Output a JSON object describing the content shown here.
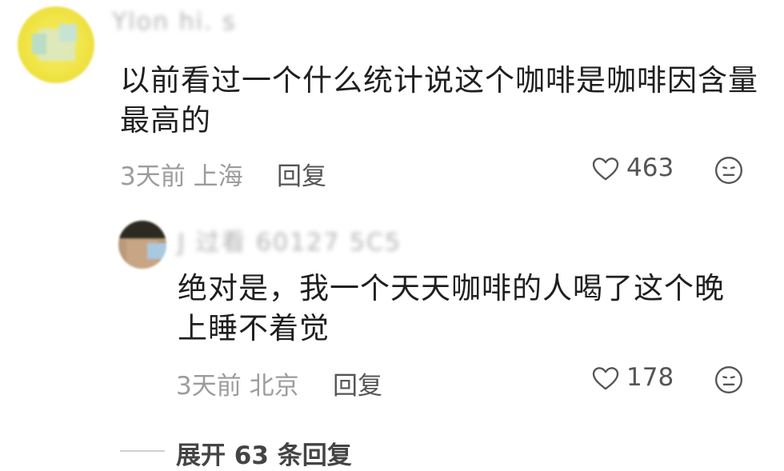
{
  "comment": {
    "username": "Ylon hi. s",
    "text": "以前看过一个什么统计说这个咖啡是咖啡因含量最高的",
    "meta": "3天前 上海",
    "reply_label": "回复",
    "likes": "463",
    "icons": {
      "like": "heart-icon",
      "dislike": "neutral-face-icon"
    }
  },
  "reply": {
    "username": "J 过看 60127 5C5",
    "text": "绝对是，我一个天天咖啡的人喝了这个晚上睡不着觉",
    "meta": "3天前 北京",
    "reply_label": "回复",
    "likes": "178",
    "icons": {
      "like": "heart-icon",
      "dislike": "neutral-face-icon"
    }
  },
  "expand": {
    "label": "展开 63 条回复"
  },
  "colors": {
    "meta_gray": "#9c9c9c",
    "text_dark": "#1f1f1f",
    "avatar_yellow": "#f0e445"
  }
}
